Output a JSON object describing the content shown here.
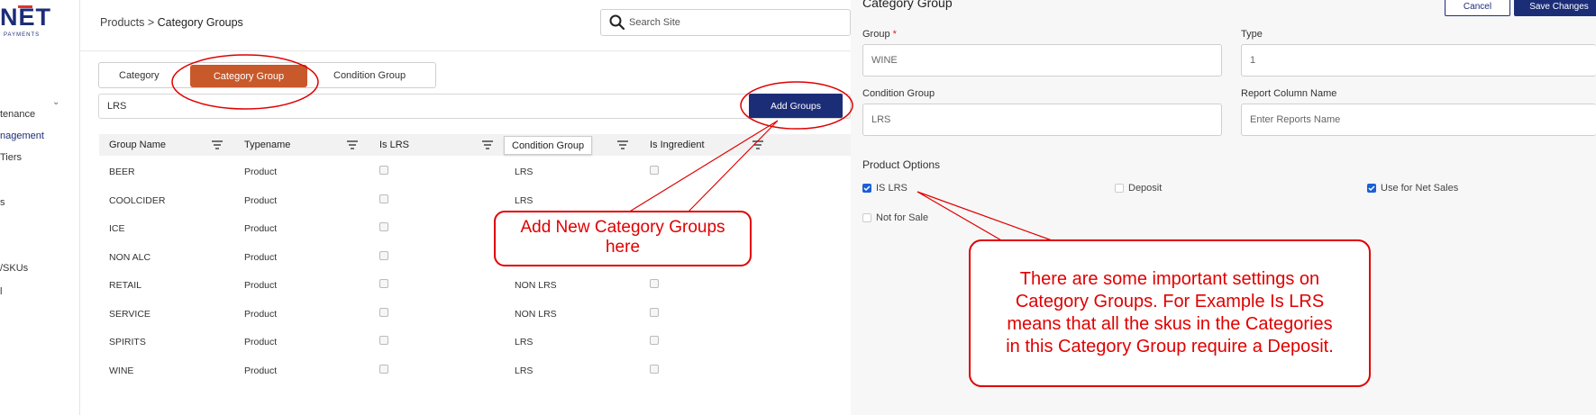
{
  "app": {
    "logo_text": "NET",
    "logo_sub": "PAYMENTS"
  },
  "sidebar": {
    "items": [
      {
        "label": "tenance"
      },
      {
        "label": "nagement"
      },
      {
        "label": "Tiers"
      },
      {
        "label": "s"
      },
      {
        "label": "/SKUs"
      },
      {
        "label": "l"
      }
    ]
  },
  "breadcrumb": {
    "parent": "Products",
    "separator": ">",
    "current": "Category Groups"
  },
  "search": {
    "placeholder": "Search Site"
  },
  "tabs": [
    {
      "label": "Category"
    },
    {
      "label": "Category Group"
    },
    {
      "label": "Condition Group"
    }
  ],
  "filter": {
    "value": "LRS"
  },
  "actions": {
    "add_groups": "Add Groups"
  },
  "table": {
    "columns": [
      "Group Name",
      "Typename",
      "Is LRS",
      "Condition Group",
      "Is Ingredient"
    ],
    "rows": [
      {
        "group": "BEER",
        "type": "Product",
        "condition": "LRS"
      },
      {
        "group": "COOLCIDER",
        "type": "Product",
        "condition": "LRS"
      },
      {
        "group": "ICE",
        "type": "Product",
        "condition": ""
      },
      {
        "group": "NON ALC",
        "type": "Product",
        "condition": ""
      },
      {
        "group": "RETAIL",
        "type": "Product",
        "condition": "NON LRS"
      },
      {
        "group": "SERVICE",
        "type": "Product",
        "condition": "NON LRS"
      },
      {
        "group": "SPIRITS",
        "type": "Product",
        "condition": "LRS"
      },
      {
        "group": "WINE",
        "type": "Product",
        "condition": "LRS"
      }
    ]
  },
  "form": {
    "title": "Category Group",
    "cancel": "Cancel",
    "save": "Save Changes",
    "group_label": "Group",
    "required_mark": "*",
    "group_value": "WINE",
    "type_label": "Type",
    "type_value": "1",
    "condition_label": "Condition Group",
    "condition_value": "LRS",
    "report_label": "Report Column Name",
    "report_placeholder": "Enter Reports Name",
    "options_title": "Product Options",
    "options": [
      {
        "label": "IS LRS",
        "checked": true
      },
      {
        "label": "Deposit",
        "checked": false
      },
      {
        "label": "Use for Net Sales",
        "checked": true
      },
      {
        "label": "Not for Sale",
        "checked": false
      }
    ]
  },
  "annotations": {
    "callout1_line1": "Add New Category Groups",
    "callout1_line2": "here",
    "callout2_line1": "There are some important settings on",
    "callout2_line2": "Category Groups. For Example Is LRS",
    "callout2_line3": "means that all the skus in the Categories",
    "callout2_line4": "in this Category Group require a Deposit.",
    "color": "#e00000"
  },
  "colors": {
    "primary": "#1c2d78",
    "active_tab": "#c8592a",
    "checkbox_on": "#1c5fd6"
  }
}
